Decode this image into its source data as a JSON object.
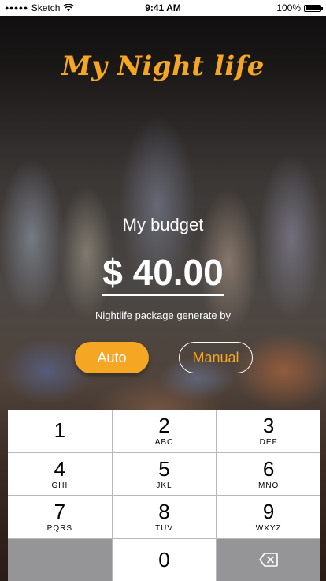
{
  "status": {
    "carrier": "Sketch",
    "time": "9:41 AM",
    "battery": "100%"
  },
  "app": {
    "title": "My Night life"
  },
  "budget": {
    "label": "My budget",
    "amount": "$ 40.00",
    "package_text": "Nightlife package generate by"
  },
  "buttons": {
    "auto": "Auto",
    "manual": "Manual"
  },
  "keypad": {
    "keys": [
      {
        "num": "1",
        "letters": ""
      },
      {
        "num": "2",
        "letters": "ABC"
      },
      {
        "num": "3",
        "letters": "DEF"
      },
      {
        "num": "4",
        "letters": "GHI"
      },
      {
        "num": "5",
        "letters": "JKL"
      },
      {
        "num": "6",
        "letters": "MNO"
      },
      {
        "num": "7",
        "letters": "PQRS"
      },
      {
        "num": "8",
        "letters": "TUV"
      },
      {
        "num": "9",
        "letters": "WXYZ"
      },
      {
        "num": "0",
        "letters": ""
      }
    ]
  },
  "colors": {
    "accent": "#f5a623",
    "text": "#ffffff"
  },
  "icons": {
    "signal": "signal-dots-icon",
    "wifi": "wifi-icon",
    "battery": "battery-icon",
    "delete": "backspace-icon"
  }
}
